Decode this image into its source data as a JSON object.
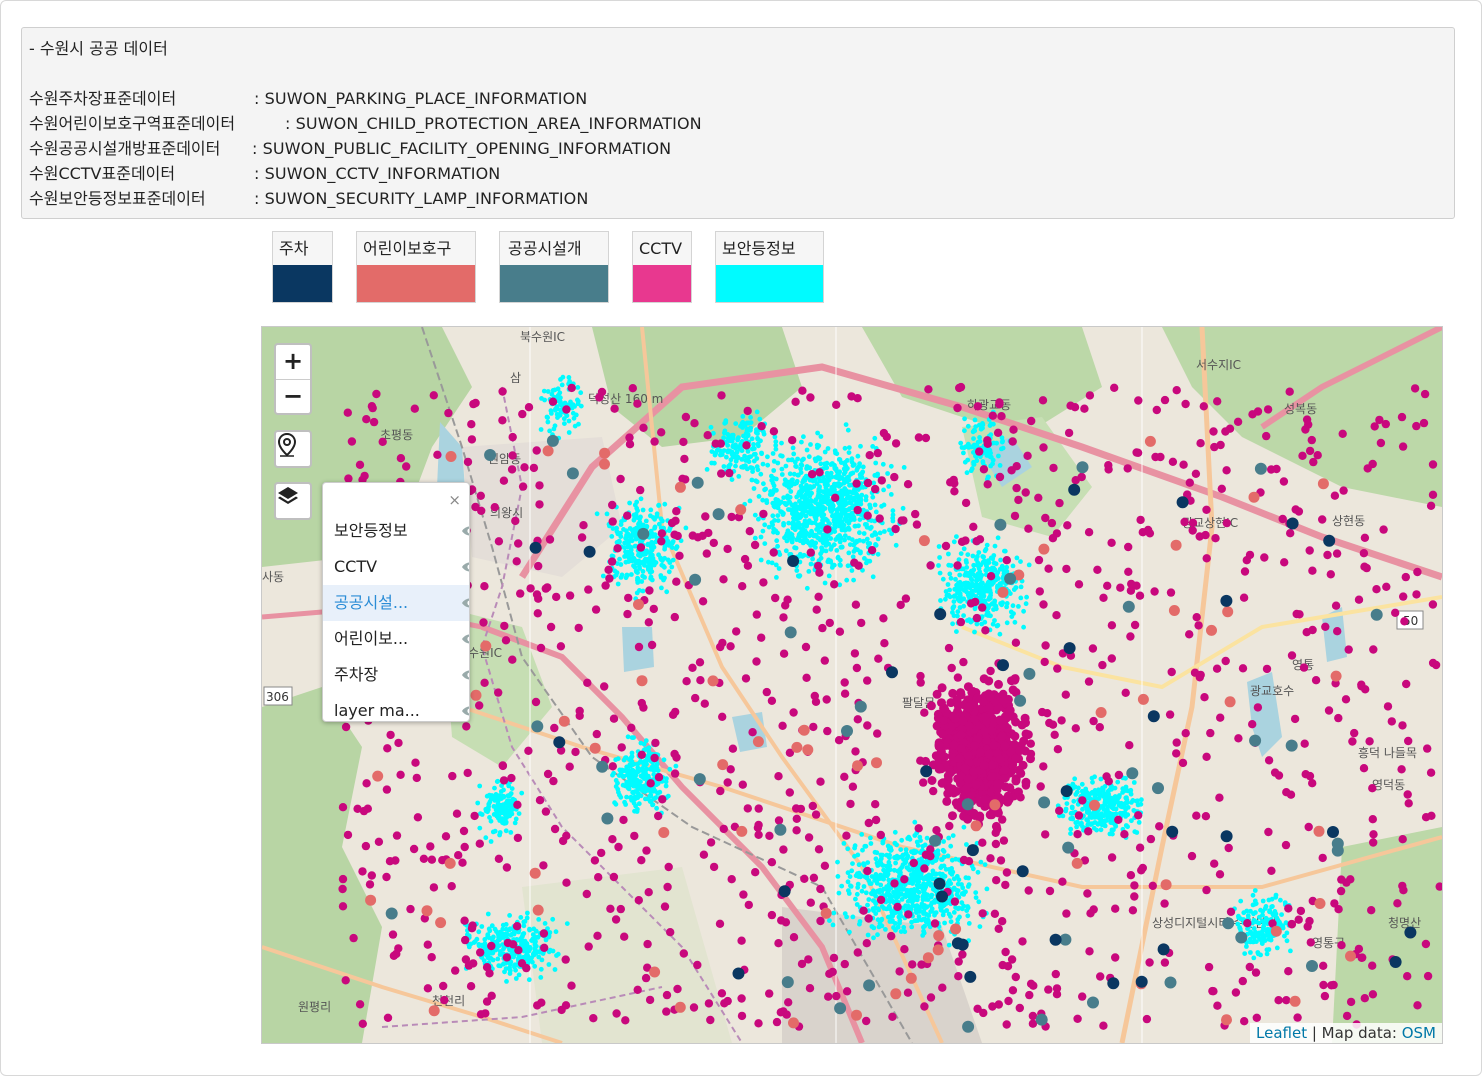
{
  "info": {
    "heading": "- 수원시 공공 데이터",
    "rows": [
      {
        "key": "수원주차장표준데이터",
        "value": ": SUWON_PARKING_PLACE_INFORMATION"
      },
      {
        "key": "수원어린이보호구역표준데이터",
        "value": ": SUWON_CHILD_PROTECTION_AREA_INFORMATION"
      },
      {
        "key": "수원공공시설개방표준데이터",
        "value": ": SUWON_PUBLIC_FACILITY_OPENING_INFORMATION"
      },
      {
        "key": "수원CCTV표준데이터",
        "value": ": SUWON_CCTV_INFORMATION"
      },
      {
        "key": "수원보안등정보표준데이터",
        "value": ": SUWON_SECURITY_LAMP_INFORMATION"
      }
    ]
  },
  "legend": [
    {
      "label": "주차",
      "color": "#0a3761"
    },
    {
      "label": "어린이보호구",
      "color": "#e36b69"
    },
    {
      "label": "공공시설개",
      "color": "#487d8b"
    },
    {
      "label": "CCTV",
      "color": "#e8388f"
    },
    {
      "label": "보안등정보",
      "color": "#00fbff"
    }
  ],
  "map": {
    "zoom_in": "+",
    "zoom_out": "−",
    "place_labels": [
      "삼",
      "초평동",
      "원암동",
      "의왕시",
      "하광교동",
      "서수지IC",
      "성복동",
      "상현동",
      "광교상현IC",
      "광교호수",
      "영덕동",
      "흥덕 나들목",
      "상성디지털시티 수원본사",
      "영통구",
      "청명산",
      "원평리",
      "천천리",
      "덕성산 160 m",
      "수원IC",
      "북수원IC",
      "영통",
      "팔달문",
      "50",
      "306",
      "사동"
    ],
    "layer_panel": {
      "close": "×",
      "items": [
        "보안등정보",
        "CCTV",
        "공공시설...",
        "어린이보...",
        "주차장",
        "layer ma..."
      ],
      "active_index": 2
    },
    "attribution": {
      "leaflet": "Leaflet",
      "sep": " | Map data: ",
      "osm": "OSM"
    }
  }
}
